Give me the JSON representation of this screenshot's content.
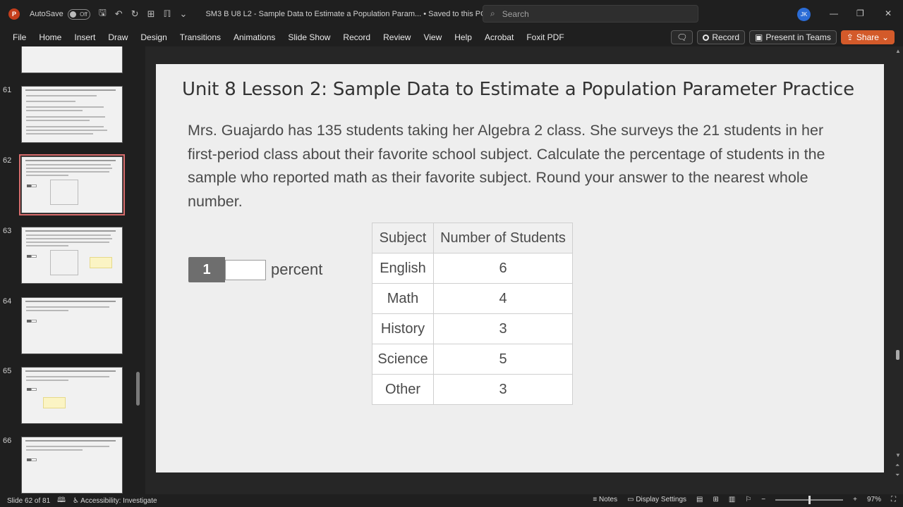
{
  "titlebar": {
    "autosave_label": "AutoSave",
    "autosave_state": "Off",
    "document_title": "SM3 B U8 L2 - Sample Data to Estimate a Population Param...  •  Saved to this PC",
    "search_placeholder": "Search",
    "user_initials": "JK"
  },
  "ribbon": {
    "tabs": [
      "File",
      "Home",
      "Insert",
      "Draw",
      "Design",
      "Transitions",
      "Animations",
      "Slide Show",
      "Record",
      "Review",
      "View",
      "Help",
      "Acrobat",
      "Foxit PDF"
    ],
    "record_label": "Record",
    "present_label": "Present in Teams",
    "share_label": "Share"
  },
  "thumbnails": [
    {
      "number": "61"
    },
    {
      "number": "62"
    },
    {
      "number": "63"
    },
    {
      "number": "64"
    },
    {
      "number": "65"
    },
    {
      "number": "66"
    }
  ],
  "slide": {
    "title": "Unit 8 Lesson 2: Sample Data to Estimate a Population Parameter Practice",
    "body": "Mrs. Guajardo has 135 students taking her Algebra 2 class. She surveys the 21 students in her first-period class about their favorite school subject. Calculate the percentage of students in the sample who reported math as their favorite subject. Round your answer to the nearest whole number.",
    "answer_number": "1",
    "answer_unit": "percent",
    "table": {
      "headers": [
        "Subject",
        "Number of Students"
      ],
      "rows": [
        [
          "English",
          "6"
        ],
        [
          "Math",
          "4"
        ],
        [
          "History",
          "3"
        ],
        [
          "Science",
          "5"
        ],
        [
          "Other",
          "3"
        ]
      ]
    }
  },
  "status": {
    "slide_indicator": "Slide 62 of 81",
    "accessibility": "Accessibility: Investigate",
    "notes_label": "Notes",
    "display_settings_label": "Display Settings",
    "zoom": "97%"
  }
}
